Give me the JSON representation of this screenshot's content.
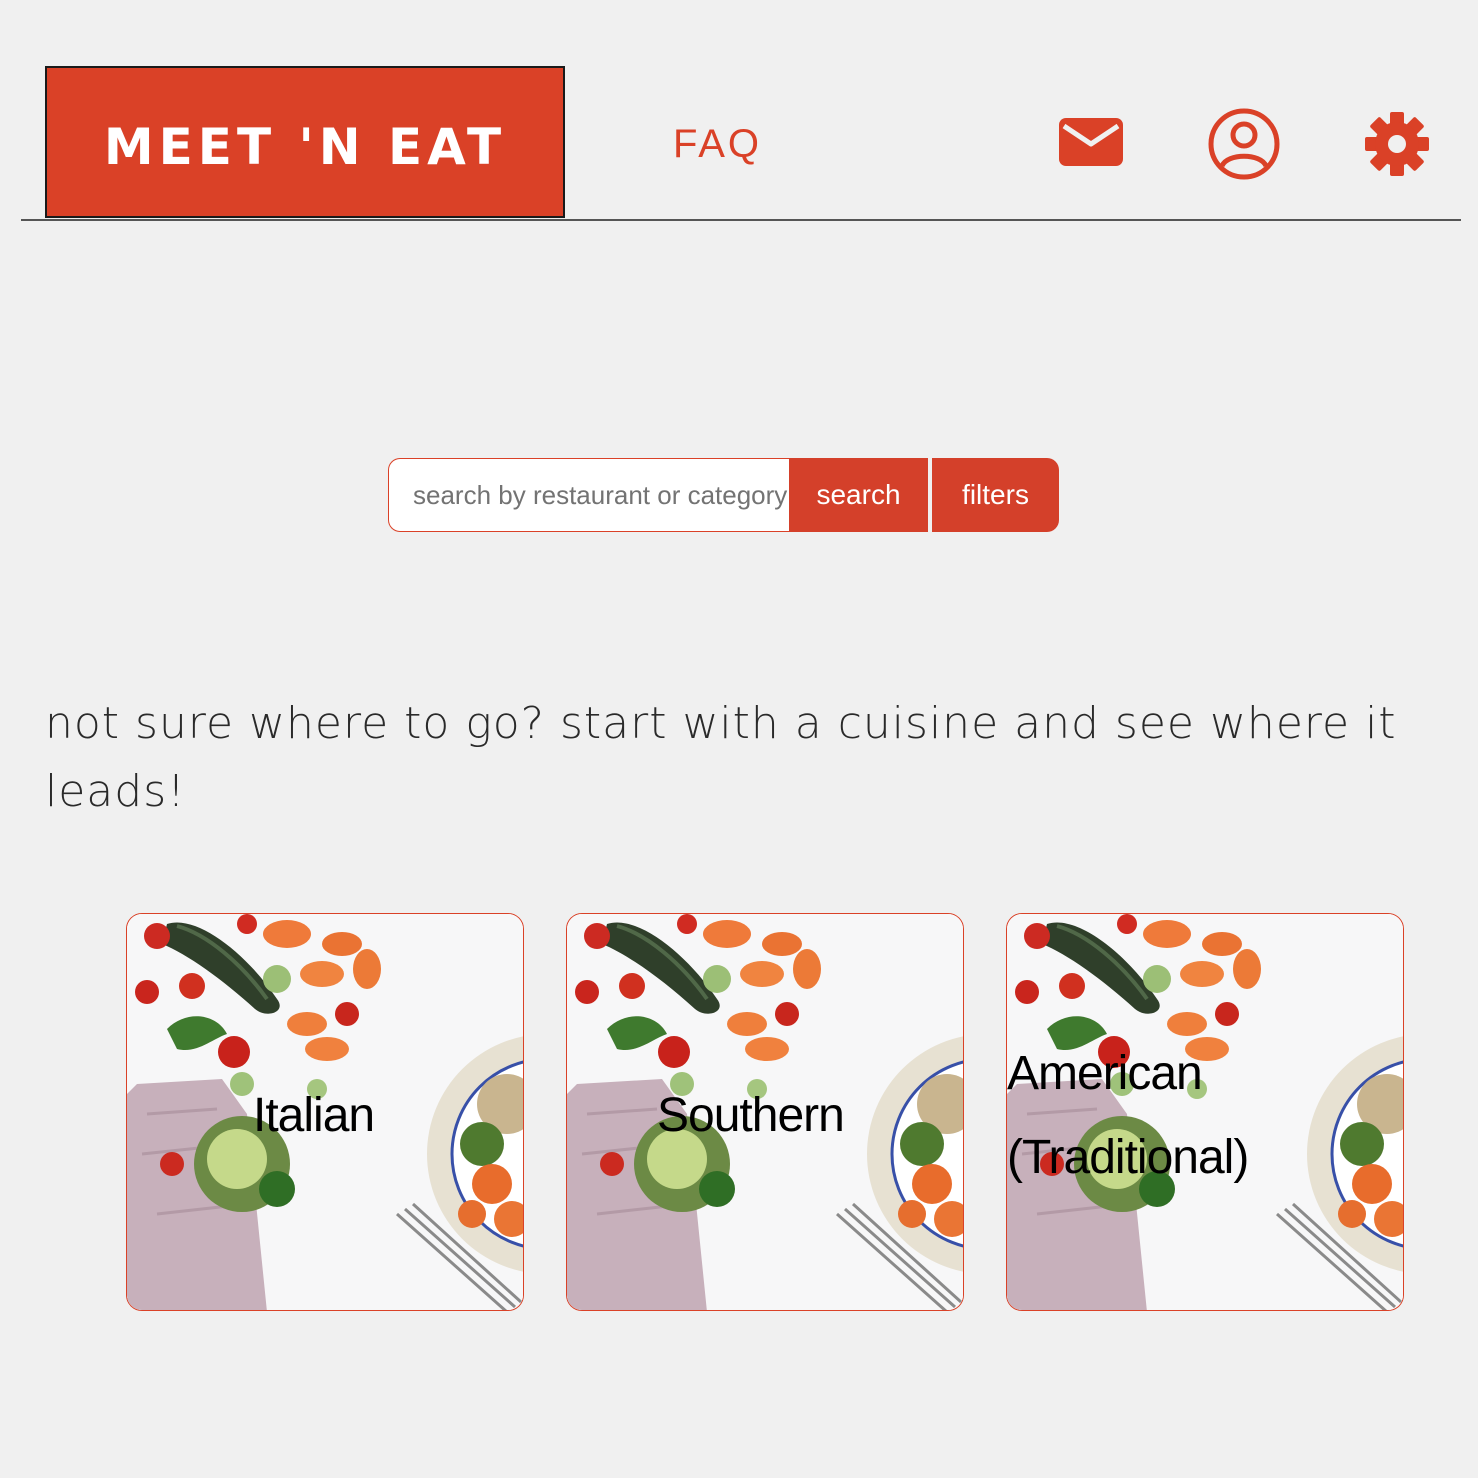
{
  "header": {
    "logo_text": "MEET 'N EAT",
    "faq_label": "FAQ",
    "icons": [
      "mail-icon",
      "profile-icon",
      "gear-icon"
    ]
  },
  "search": {
    "placeholder": "search by restaurant or category",
    "value": "",
    "search_label": "search",
    "filters_label": "filters"
  },
  "tagline": "not sure where to go? start with a cuisine and see where it leads!",
  "cuisines": [
    {
      "label": "Italian"
    },
    {
      "label": "Southern"
    },
    {
      "label_line1": "American",
      "label_line2": "(Traditional)"
    }
  ],
  "colors": {
    "accent": "#da4127",
    "background": "#f0f0f0"
  }
}
